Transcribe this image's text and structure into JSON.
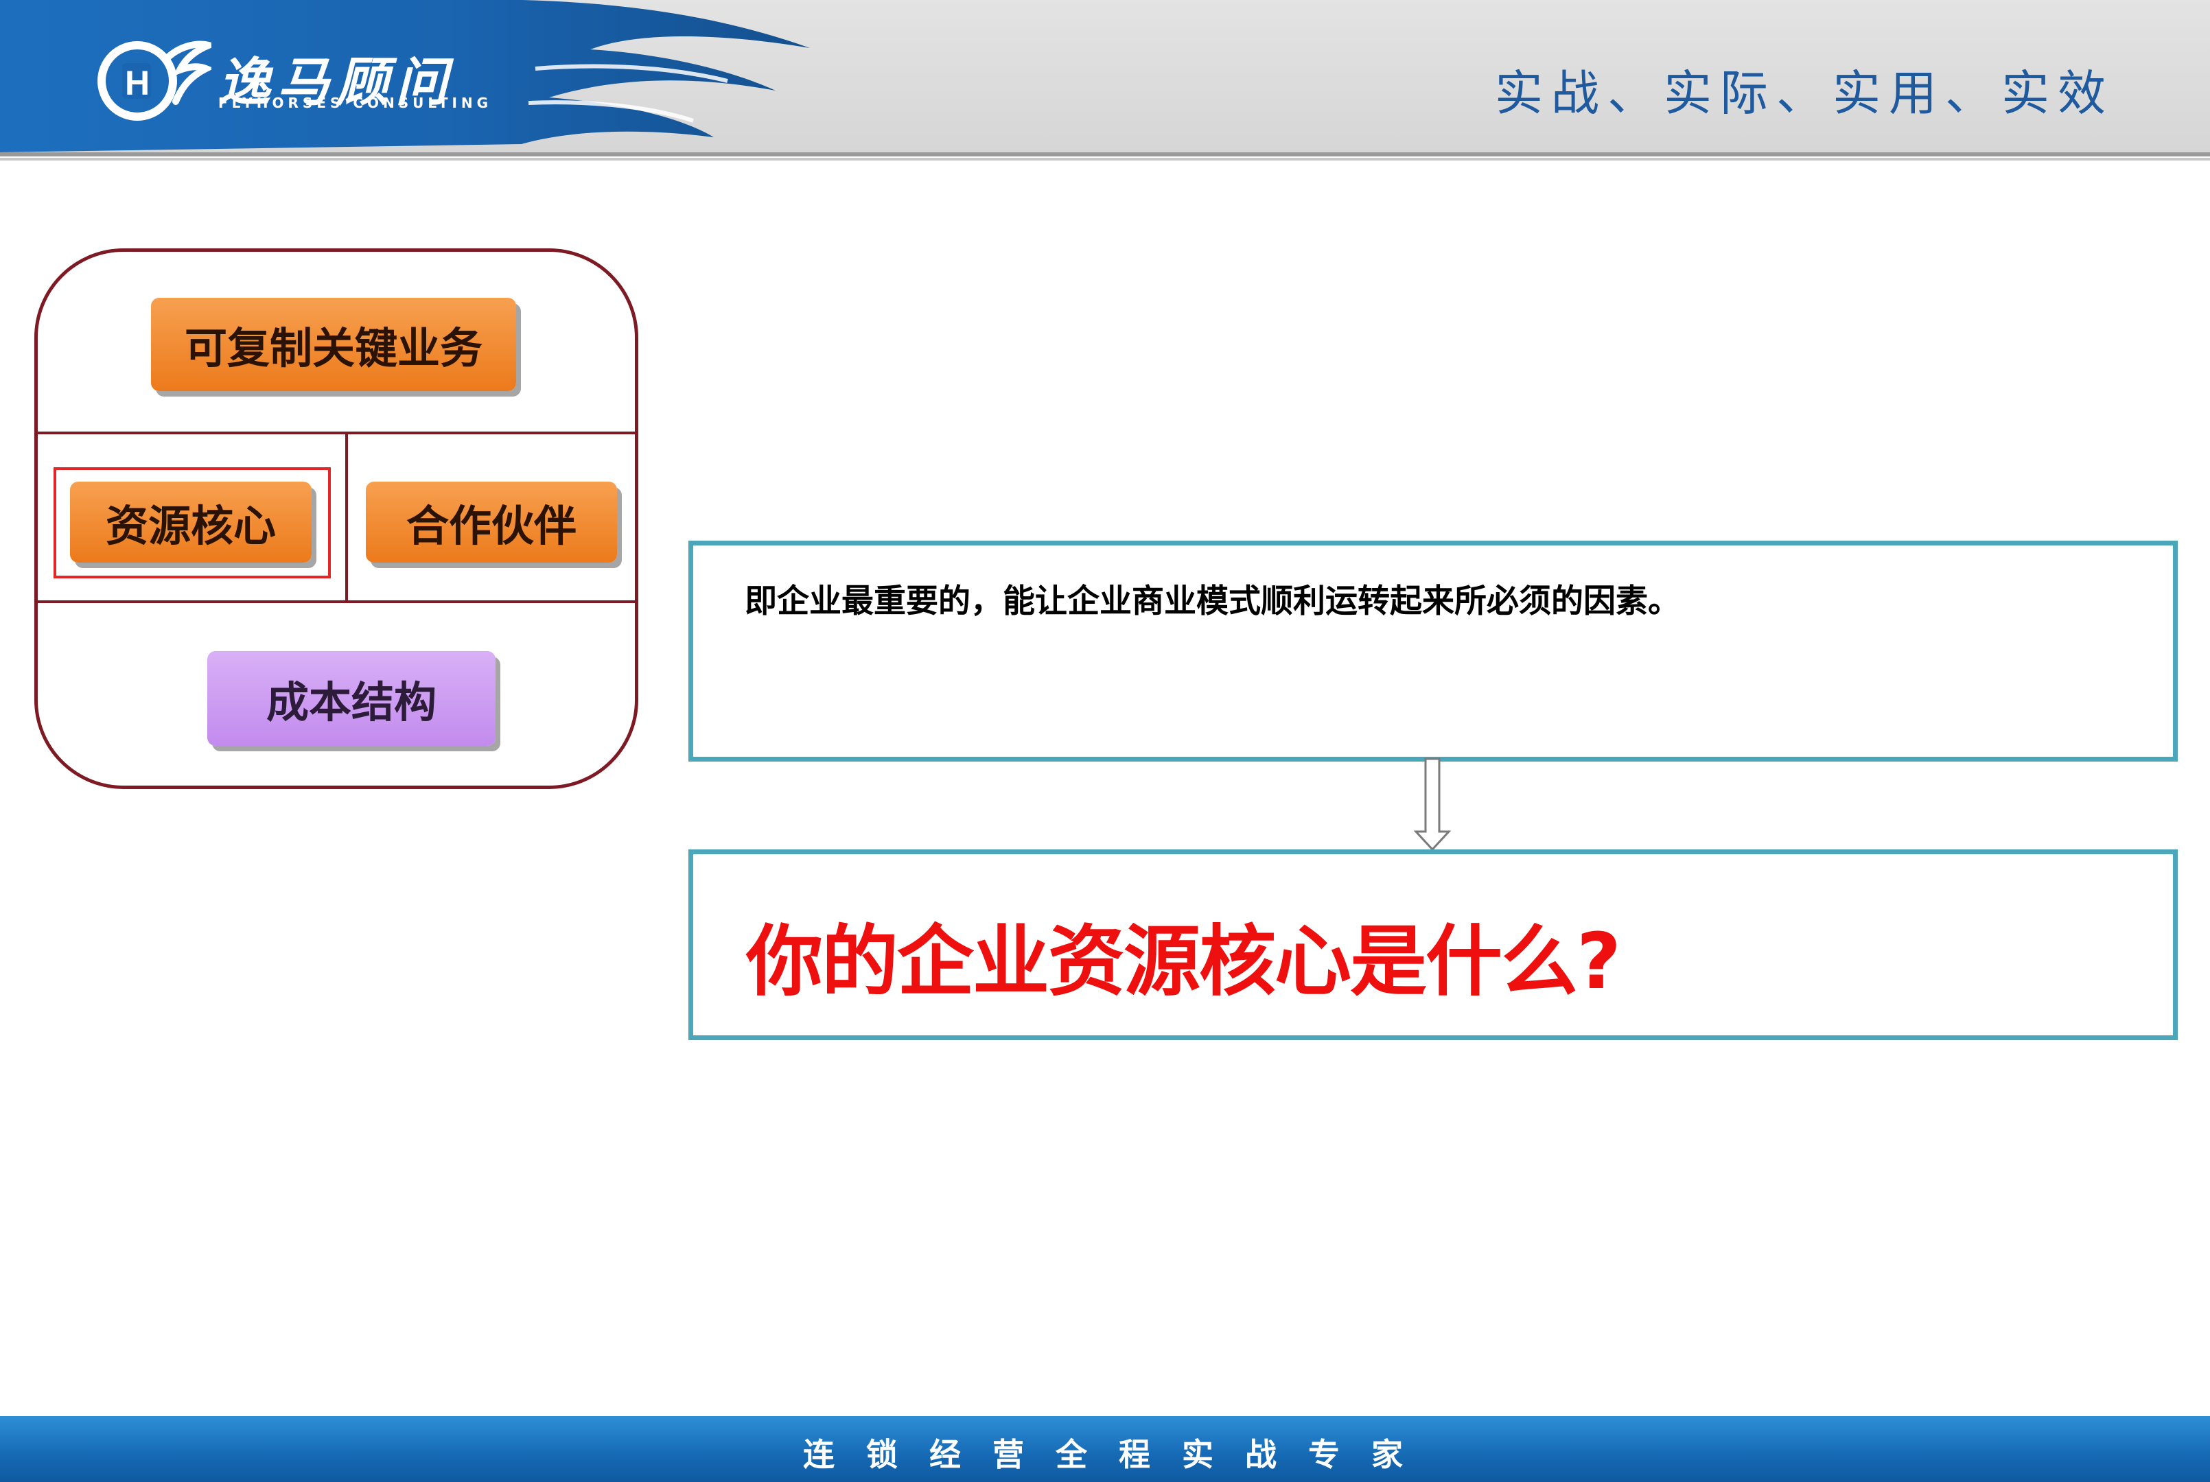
{
  "header": {
    "logo_cn": "逸马顾问",
    "logo_en": "FLYHORSES CONSULTING",
    "slogan": "实战、实际、实用、实效"
  },
  "canvas": {
    "key_activities": "可复制关键业务",
    "key_resources": "资源核心",
    "key_partners": "合作伙伴",
    "cost_structure": "成本结构"
  },
  "definition": {
    "text": "即企业最重要的，能让企业商业模式顺利运转起来所必须的因素。"
  },
  "question": {
    "text": "你的企业资源核心是什么?"
  },
  "footer": {
    "text": "连锁经营全程实战专家"
  },
  "colors": {
    "brand_blue": "#1669b4",
    "panel_border": "#7d1a24",
    "block_orange": "#ec7a1b",
    "block_purple": "#c28bee",
    "box_teal": "#4aa6b8",
    "question_red": "#ee0f0f"
  }
}
